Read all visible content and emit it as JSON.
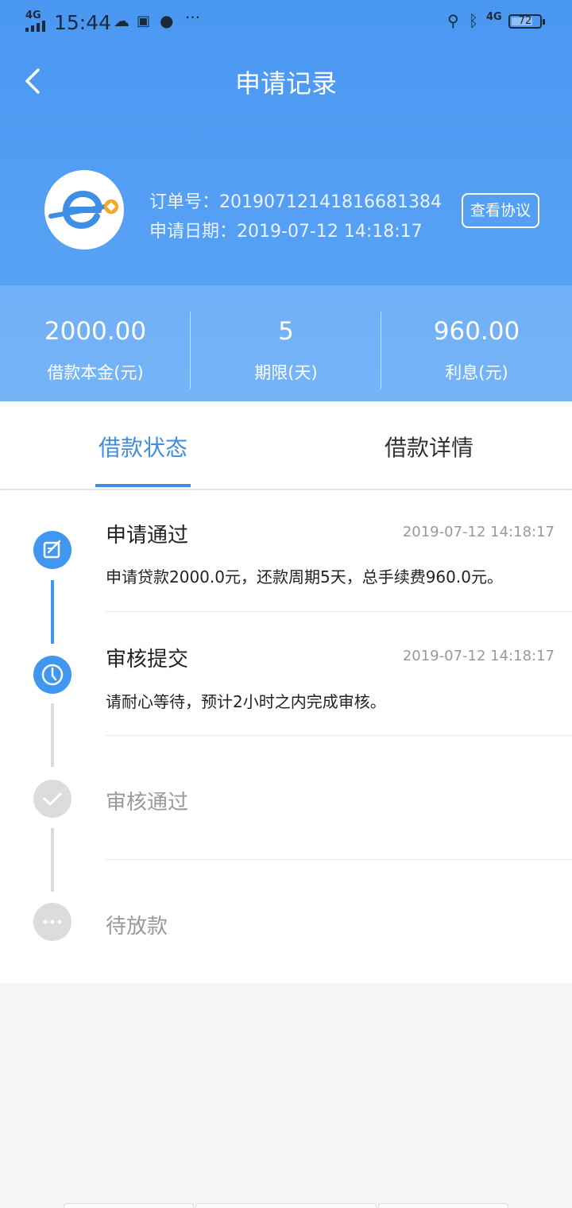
{
  "status_bar": {
    "network": "4G",
    "time": "15:44",
    "right_network": "4G",
    "battery": "72"
  },
  "header": {
    "title": "申请记录",
    "order_label": "订单号：",
    "order_no": "20190712141816681384",
    "date_label": "申请日期：",
    "apply_date": "2019-07-12 14:18:17",
    "protocol_button": "查看协议"
  },
  "stats": [
    {
      "value": "2000.00",
      "label": "借款本金(元)"
    },
    {
      "value": "5",
      "label": "期限(天)"
    },
    {
      "value": "960.00",
      "label": "利息(元)"
    }
  ],
  "tabs": [
    {
      "label": "借款状态",
      "active": true
    },
    {
      "label": "借款详情",
      "active": false
    }
  ],
  "timeline": [
    {
      "title": "申请通过",
      "time": "2019-07-12 14:18:17",
      "desc": "申请贷款2000.0元，还款周期5天，总手续费960.0元。",
      "status": "done",
      "icon": "edit-icon"
    },
    {
      "title": "审核提交",
      "time": "2019-07-12 14:18:17",
      "desc": "请耐心等待，预计2小时之内完成审核。",
      "status": "done",
      "icon": "clock-icon"
    },
    {
      "title": "审核通过",
      "time": "",
      "desc": "",
      "status": "pending",
      "icon": "check-icon"
    },
    {
      "title": "待放款",
      "time": "",
      "desc": "",
      "status": "pending",
      "icon": "ellipsis-icon"
    }
  ],
  "colors": {
    "header_blue": "#4a97f2",
    "accent": "#3f8ee6",
    "node_done": "#4197ef",
    "node_pending": "#dcdcdc",
    "logo_orange": "#f5a623"
  }
}
